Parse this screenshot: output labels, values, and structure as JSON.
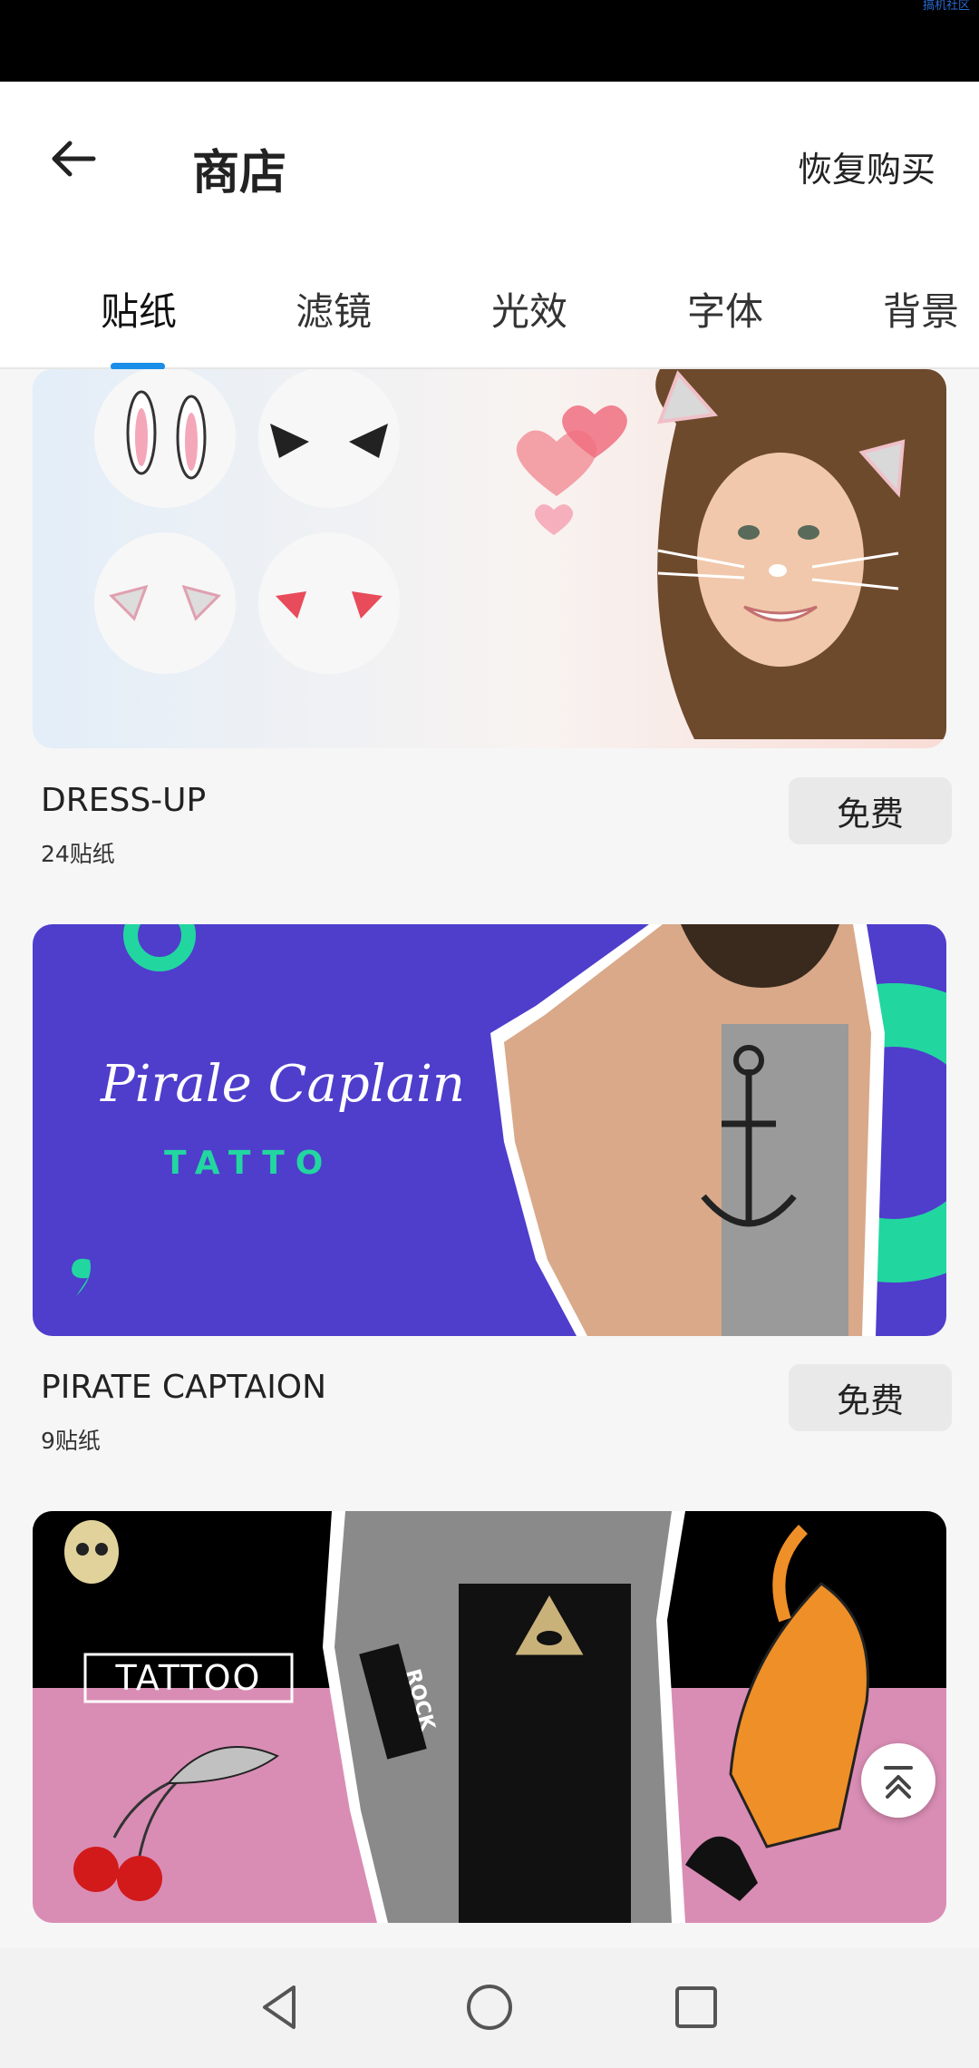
{
  "status_bar": {
    "watermark": "搞机社区"
  },
  "header": {
    "title": "商店",
    "restore_label": "恢复购买"
  },
  "tabs": [
    {
      "label": "贴纸",
      "active": true
    },
    {
      "label": "滤镜",
      "active": false
    },
    {
      "label": "光效",
      "active": false
    },
    {
      "label": "字体",
      "active": false
    },
    {
      "label": "背景",
      "active": false
    }
  ],
  "items": [
    {
      "title": "DRESS-UP",
      "subtitle": "24贴纸",
      "button_label": "免费"
    },
    {
      "title": "PIRATE CAPTAION",
      "subtitle": "9贴纸",
      "button_label": "免费",
      "banner_text": "Pirale Caplain",
      "banner_subtext": "TATTO"
    },
    {
      "banner_text": "TATTOO",
      "banner_subtext": "ROCK"
    }
  ],
  "colors": {
    "accent": "#1a8ee8",
    "banner2_bg": "#4f3dcc",
    "banner2_ring": "#22d6a0",
    "banner3_pink": "#d98db4"
  },
  "icons": [
    "back-arrow-icon",
    "scroll-to-top-icon",
    "nav-back-icon",
    "nav-home-icon",
    "nav-recents-icon"
  ]
}
